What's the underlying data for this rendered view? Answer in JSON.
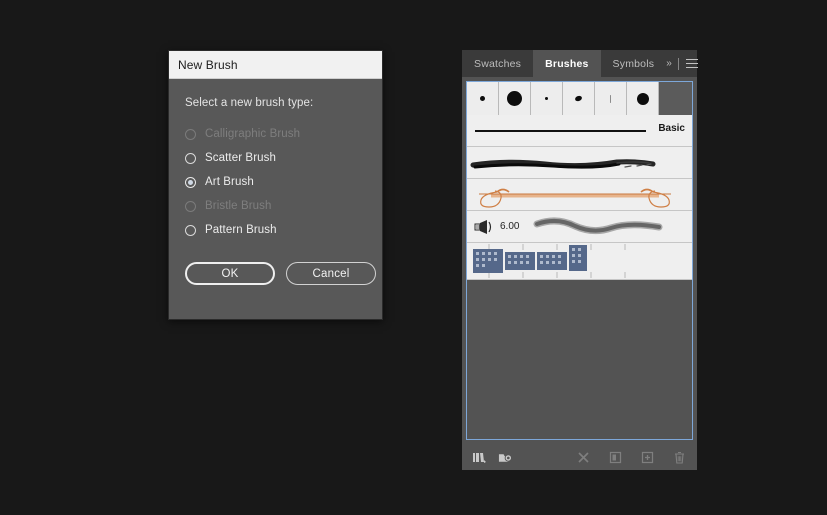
{
  "dialog": {
    "title": "New Brush",
    "prompt": "Select a new brush type:",
    "options": [
      {
        "label": "Calligraphic Brush",
        "selected": false,
        "disabled": true
      },
      {
        "label": "Scatter Brush",
        "selected": false,
        "disabled": false
      },
      {
        "label": "Art Brush",
        "selected": true,
        "disabled": false
      },
      {
        "label": "Bristle Brush",
        "selected": false,
        "disabled": true
      },
      {
        "label": "Pattern Brush",
        "selected": false,
        "disabled": false
      }
    ],
    "ok_label": "OK",
    "cancel_label": "Cancel"
  },
  "panel": {
    "tabs": [
      {
        "label": "Swatches",
        "active": false
      },
      {
        "label": "Brushes",
        "active": true
      },
      {
        "label": "Symbols",
        "active": false
      }
    ],
    "expand_icon": "double-chevron-right-icon",
    "menu_icon": "panel-menu-icon",
    "calligraphic_swatches": [
      {
        "name": "calligraphic-3pt",
        "size": 5
      },
      {
        "name": "calligraphic-10pt",
        "size": 15
      },
      {
        "name": "calligraphic-1pt",
        "size": 3
      },
      {
        "name": "calligraphic-oval",
        "size": 6
      },
      {
        "name": "calligraphic-thin",
        "size": 2
      },
      {
        "name": "calligraphic-round",
        "size": 12
      }
    ],
    "brush_rows": [
      {
        "name": "basic-brush",
        "type": "basic",
        "label": "Basic"
      },
      {
        "name": "charcoal-brush",
        "type": "charcoal",
        "label": ""
      },
      {
        "name": "ornament-art-brush",
        "type": "art",
        "label": ""
      },
      {
        "name": "bristle-brush",
        "type": "bristle",
        "label": "6.00"
      },
      {
        "name": "pattern-brush",
        "type": "pattern",
        "label": ""
      }
    ],
    "bottom_toolbar": [
      {
        "name": "brush-libraries-menu-icon",
        "enabled": true
      },
      {
        "name": "libraries-panel-icon",
        "enabled": true
      },
      {
        "name": "remove-brush-stroke-icon",
        "enabled": false
      },
      {
        "name": "brush-options-icon",
        "enabled": false
      },
      {
        "name": "new-brush-icon",
        "enabled": false
      },
      {
        "name": "delete-brush-icon",
        "enabled": false
      }
    ]
  },
  "colors": {
    "app_background": "#181818",
    "dialog_body": "#585858",
    "dialog_titlebar": "#f1f1f1",
    "panel_background": "#535353",
    "panel_tabbar": "#3a3a3a",
    "selection_border": "#7da7d9",
    "list_background": "#efefef",
    "art_brush_accent": "#d98a4f"
  }
}
